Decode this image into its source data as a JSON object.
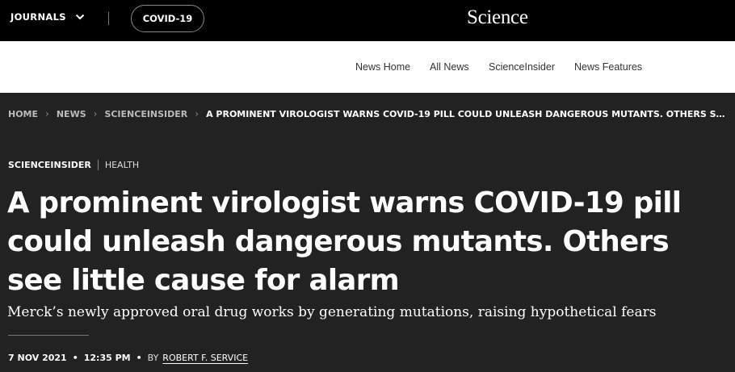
{
  "topbar": {
    "journals_label": "JOURNALS",
    "covid_label": "COVID-19",
    "logo": "Science"
  },
  "subnav": {
    "items": [
      "News Home",
      "All News",
      "ScienceInsider",
      "News Features"
    ]
  },
  "breadcrumb": {
    "items": [
      "HOME",
      "NEWS",
      "SCIENCEINSIDER"
    ],
    "current": "A PROMINENT VIROLOGIST WARNS COVID-19 PILL COULD UNLEASH DANGEROUS MUTANTS. OTHERS SEE LITTLE..."
  },
  "article": {
    "section": "SCIENCEINSIDER",
    "topic": "HEALTH",
    "headline": "A prominent virologist warns COVID-19 pill could unleash dangerous mutants. Others see little cause for alarm",
    "dek": "Merck’s newly approved oral drug works by generating mutations, raising hypothetical fears",
    "date": "7 NOV 2021",
    "time": "12:35 PM",
    "by": "BY",
    "author": "ROBERT F. SERVICE"
  },
  "colors": {
    "topbar_bg": "#000000",
    "page_bg": "#222222",
    "subnav_bg": "#ffffff"
  },
  "icons": {
    "journals_toggle": "chevron-down-icon",
    "breadcrumb_separator": "chevron-right-icon"
  }
}
